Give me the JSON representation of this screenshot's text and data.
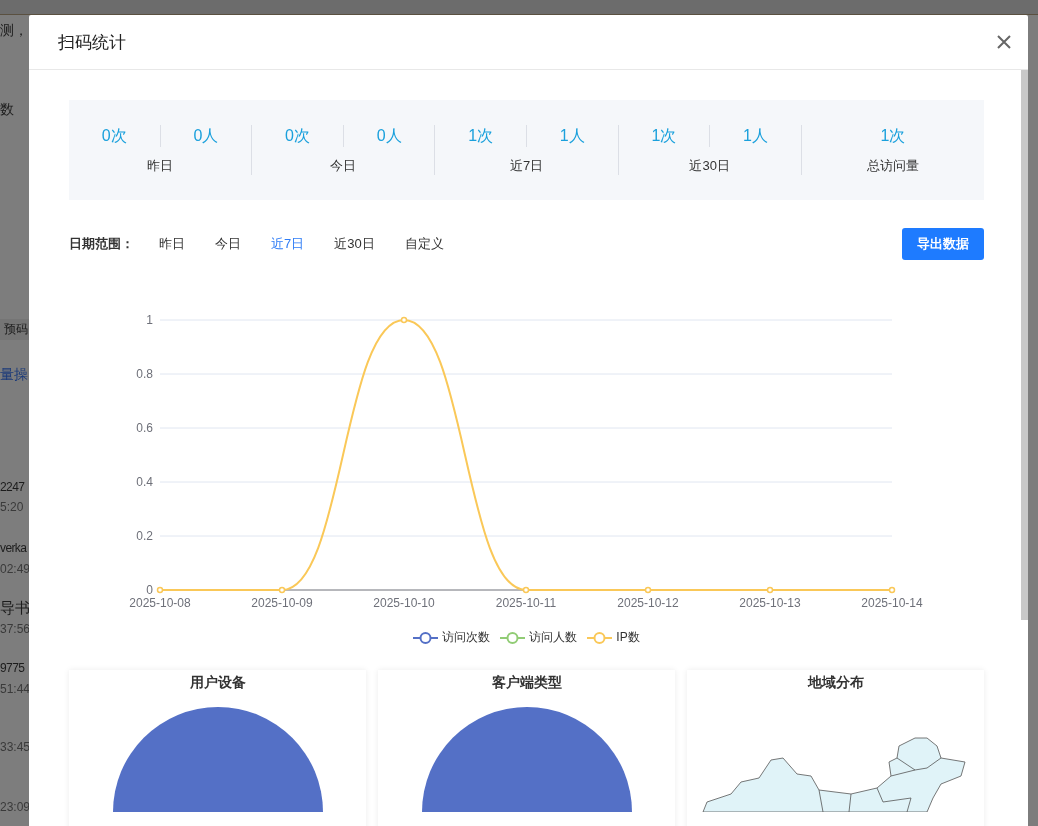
{
  "background": {
    "texts": [
      {
        "text": "测，"
      },
      {
        "text": "数"
      },
      {
        "text": "预码"
      },
      {
        "text": "量操"
      },
      {
        "text": "2247"
      },
      {
        "text": "5:20"
      },
      {
        "text": "verka"
      },
      {
        "text": "02:49"
      },
      {
        "text": "导书"
      },
      {
        "text": "37:56"
      },
      {
        "text": "9775"
      },
      {
        "text": "51:44"
      },
      {
        "text": "33:45"
      },
      {
        "text": "23:09"
      }
    ]
  },
  "dialog": {
    "title": "扫码统计"
  },
  "stats": [
    {
      "values": [
        "0次",
        "0人"
      ],
      "label": "昨日"
    },
    {
      "values": [
        "0次",
        "0人"
      ],
      "label": "今日"
    },
    {
      "values": [
        "1次",
        "1人"
      ],
      "label": "近7日"
    },
    {
      "values": [
        "1次",
        "1人"
      ],
      "label": "近30日"
    },
    {
      "values": [
        "1次"
      ],
      "label": "总访问量"
    }
  ],
  "date_range": {
    "label": "日期范围：",
    "options": [
      {
        "label": "昨日",
        "selected": false
      },
      {
        "label": "今日",
        "selected": false
      },
      {
        "label": "近7日",
        "selected": true
      },
      {
        "label": "近30日",
        "selected": false
      },
      {
        "label": "自定义",
        "selected": false
      }
    ]
  },
  "export_button": "导出数据",
  "trend": {
    "chart_data": {
      "type": "line",
      "categories": [
        "2025-10-08",
        "2025-10-09",
        "2025-10-10",
        "2025-10-11",
        "2025-10-12",
        "2025-10-13",
        "2025-10-14"
      ],
      "grid": true,
      "ylim": [
        0,
        1
      ],
      "yticks": [
        0,
        0.2,
        0.4,
        0.6,
        0.8,
        1
      ],
      "series": [
        {
          "name": "访问次数",
          "color": "#5470c6",
          "values": [
            null,
            null,
            null,
            null,
            null,
            null,
            null
          ]
        },
        {
          "name": "访问人数",
          "color": "#91cc75",
          "values": [
            null,
            null,
            null,
            null,
            null,
            null,
            null
          ]
        },
        {
          "name": "IP数",
          "color": "#fac858",
          "marker": true,
          "values": [
            0,
            0,
            1,
            0,
            0,
            0,
            0
          ]
        }
      ]
    }
  },
  "panels": [
    {
      "title": "用户设备",
      "kind": "pie"
    },
    {
      "title": "客户端类型",
      "kind": "pie"
    },
    {
      "title": "地域分布",
      "kind": "map"
    }
  ]
}
